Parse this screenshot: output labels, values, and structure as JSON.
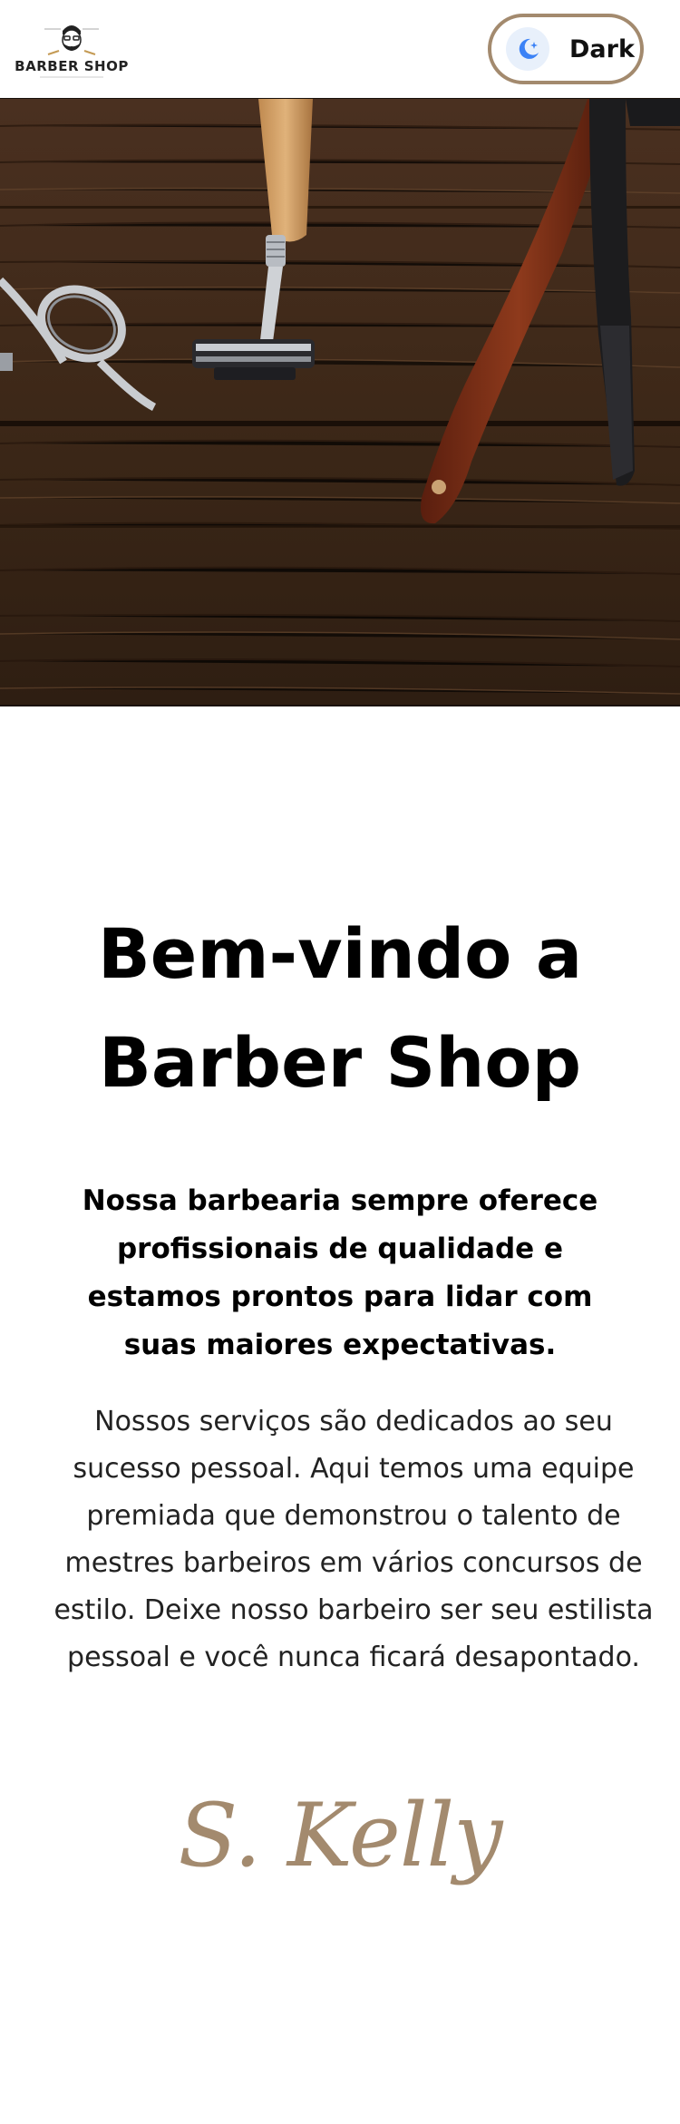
{
  "header": {
    "logo_text": "BARBER SHOP",
    "theme_toggle_label": "Dark"
  },
  "hero": {
    "image": "barber-tools-on-wood"
  },
  "main": {
    "title": "Bem-vindo a Barber Shop",
    "subtitle": "Nossa barbearia sempre oferece profissionais de qualidade e estamos prontos para lidar com suas maiores expectativas.",
    "body": "Nossos serviços são dedicados ao seu sucesso pessoal. Aqui temos uma equipe premiada que demonstrou o talento de mestres barbeiros em vários concursos de estilo. Deixe nosso barbeiro ser seu estilista pessoal e você nunca ficará desapontado.",
    "signature": "S. Kelly"
  },
  "colors": {
    "accent": "#a38a6e",
    "text": "#000000",
    "background": "#ffffff"
  },
  "icons": {
    "logo": "barber-face-logo",
    "toggle": "moon-icon"
  }
}
